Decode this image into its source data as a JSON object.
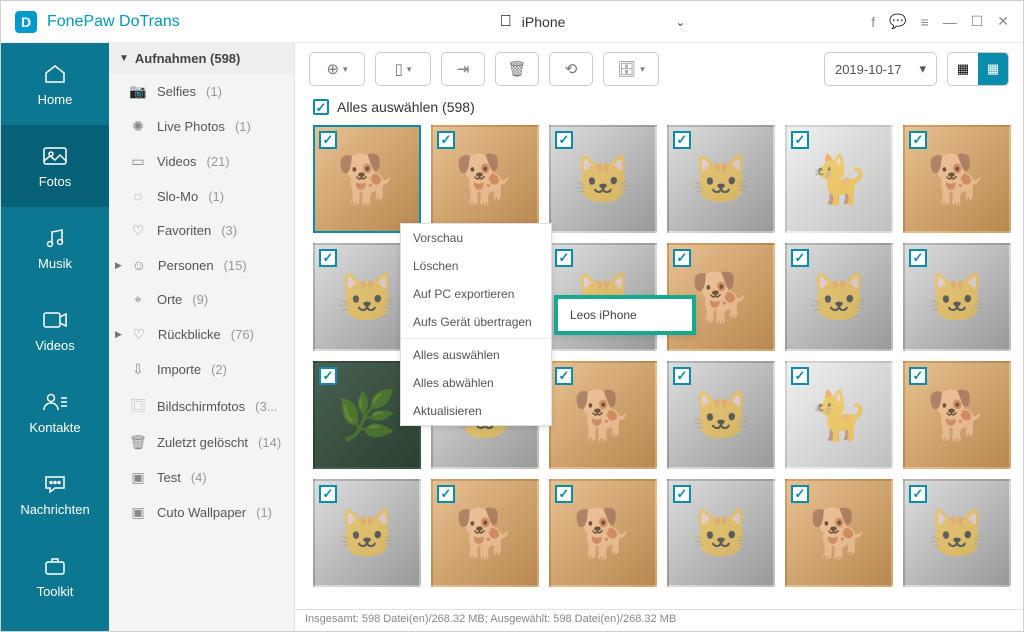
{
  "app": {
    "title": "FonePaw DoTrans",
    "logo_letter": "D"
  },
  "device": {
    "name": "iPhone"
  },
  "nav": [
    {
      "key": "home",
      "label": "Home"
    },
    {
      "key": "fotos",
      "label": "Fotos"
    },
    {
      "key": "musik",
      "label": "Musik"
    },
    {
      "key": "videos",
      "label": "Videos"
    },
    {
      "key": "kontakte",
      "label": "Kontakte"
    },
    {
      "key": "nachrichten",
      "label": "Nachrichten"
    },
    {
      "key": "toolkit",
      "label": "Toolkit"
    }
  ],
  "nav_active": "fotos",
  "sidebar": {
    "header": "Aufnahmen (598)",
    "items": [
      {
        "icon": "camera",
        "label": "Selfies",
        "count": "(1)"
      },
      {
        "icon": "burst",
        "label": "Live Photos",
        "count": "(1)"
      },
      {
        "icon": "video",
        "label": "Videos",
        "count": "(21)"
      },
      {
        "icon": "slomo",
        "label": "Slo-Mo",
        "count": "(1)"
      },
      {
        "icon": "heart",
        "label": "Favoriten",
        "count": "(3)"
      },
      {
        "icon": "person",
        "label": "Personen",
        "count": "(15)",
        "expandable": true
      },
      {
        "icon": "pin",
        "label": "Orte",
        "count": "(9)"
      },
      {
        "icon": "heart",
        "label": "Rückblicke",
        "count": "(76)",
        "expandable": true
      },
      {
        "icon": "import",
        "label": "Importe",
        "count": "(2)"
      },
      {
        "icon": "screenshot",
        "label": "Bildschirmfotos",
        "count": "(3..."
      },
      {
        "icon": "trash",
        "label": "Zuletzt gelöscht",
        "count": "(14)"
      },
      {
        "icon": "album",
        "label": "Test",
        "count": "(4)"
      },
      {
        "icon": "album",
        "label": "Cuto Wallpaper",
        "count": "(1)"
      }
    ]
  },
  "toolbar": {
    "date": "2019-10-17"
  },
  "select_all": {
    "label": "Alles auswählen (598)"
  },
  "context_menu": {
    "items": [
      "Vorschau",
      "Löschen",
      "Auf PC exportieren",
      "Aufs Gerät übertragen"
    ],
    "items2": [
      "Alles auswählen",
      "Alles abwählen",
      "Aktualisieren"
    ],
    "submenu": "Leos iPhone"
  },
  "status": "Insgesamt: 598 Datei(en)/268.32 MB; Ausgewählt: 598 Datei(en)/268.32 MB",
  "thumbs": [
    "b",
    "b",
    "a",
    "a",
    "c",
    "b",
    "a",
    "a",
    "a",
    "b",
    "a",
    "a",
    "d",
    "a",
    "b",
    "a",
    "c",
    "b",
    "a",
    "b",
    "b",
    "a",
    "b",
    "a"
  ]
}
